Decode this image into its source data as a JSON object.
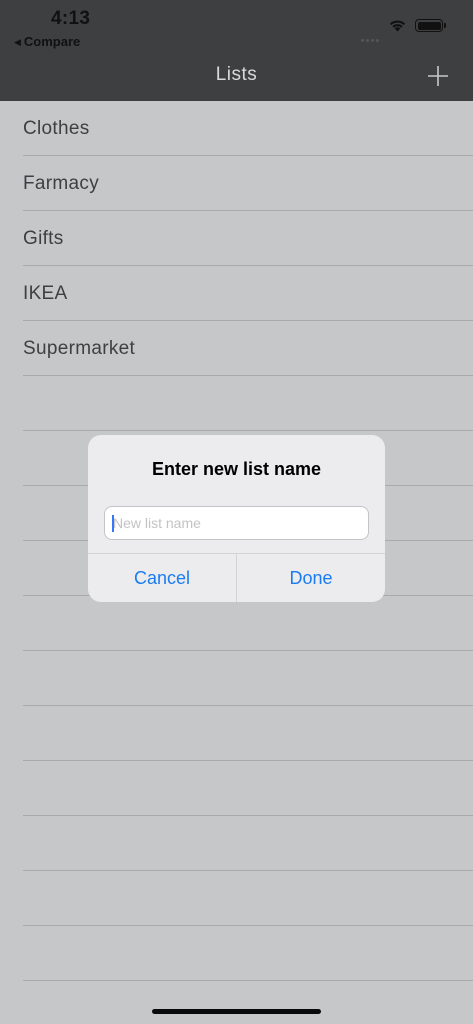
{
  "status_bar": {
    "time": "4:13",
    "back_label": "Compare",
    "back_glyph": "◀"
  },
  "nav": {
    "title": "Lists",
    "add_icon": "plus-icon"
  },
  "lists": [
    {
      "label": "Clothes"
    },
    {
      "label": "Farmacy"
    },
    {
      "label": "Gifts"
    },
    {
      "label": "IKEA"
    },
    {
      "label": "Supermarket"
    },
    {
      "label": ""
    },
    {
      "label": ""
    },
    {
      "label": ""
    },
    {
      "label": ""
    },
    {
      "label": ""
    },
    {
      "label": ""
    },
    {
      "label": ""
    },
    {
      "label": ""
    },
    {
      "label": ""
    },
    {
      "label": ""
    },
    {
      "label": ""
    }
  ],
  "alert": {
    "title": "Enter new list name",
    "input_value": "",
    "input_placeholder": "New list name",
    "cancel_label": "Cancel",
    "done_label": "Done"
  },
  "colors": {
    "header_bg": "#3e3f41",
    "list_bg": "#c6c7c9",
    "accent": "#1a7cf0"
  }
}
